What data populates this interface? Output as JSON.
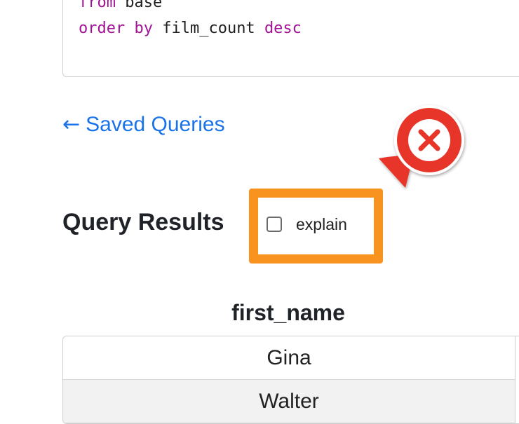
{
  "code": {
    "line1": {
      "keyword": "from",
      "rest": " base"
    },
    "line2": {
      "keyword1": "order",
      "keyword2": "by",
      "ident": " film_count ",
      "keyword3": "desc"
    }
  },
  "nav": {
    "back_arrow": "←",
    "back_label": "Saved Queries"
  },
  "results": {
    "title": "Query Results",
    "explain_label": "explain",
    "explain_checked": false
  },
  "table": {
    "column_header": "first_name",
    "rows": [
      "Gina",
      "Walter"
    ]
  },
  "colors": {
    "highlight": "#f7931e",
    "error_pin": "#e8352b",
    "link": "#1a73e8",
    "keyword": "#a01395"
  },
  "icons": {
    "error_pin": "close-x-icon"
  }
}
